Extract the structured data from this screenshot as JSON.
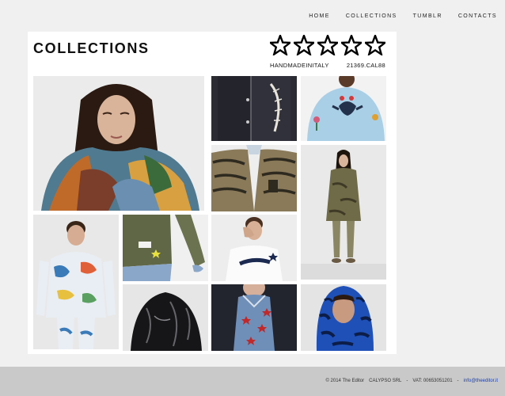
{
  "nav": {
    "items": [
      {
        "label": "HOME"
      },
      {
        "label": "COLLECTIONS"
      },
      {
        "label": "TUMBLR"
      },
      {
        "label": "CONTACTS"
      }
    ]
  },
  "header": {
    "title": "COLLECTIONS",
    "rating": 5,
    "tagline": "HANDMADEINITALY",
    "code": "21369.CAL88"
  },
  "gallery": {
    "tiles": [
      {
        "name": "woman-fur-coat-photo",
        "bg": "#eaeaea"
      },
      {
        "name": "denim-jacket-embroidery-photo",
        "bg": "#2a2a30"
      },
      {
        "name": "embroidered-eagle-jacket-photo",
        "bg": "#a8cde6"
      },
      {
        "name": "tiger-camo-jacket-photo",
        "bg": "#ececec"
      },
      {
        "name": "model-camo-parka-photo",
        "bg": "#e8e8e8"
      },
      {
        "name": "painted-print-suit-photo",
        "bg": "#e6e6e6"
      },
      {
        "name": "olive-pants-cuff-photo",
        "bg": "#5c6448"
      },
      {
        "name": "editor-tshirt-photo",
        "bg": "#ececec"
      },
      {
        "name": "black-vinyl-jacket-photo",
        "bg": "#e6e6e6"
      },
      {
        "name": "star-print-shirt-photo",
        "bg": "#1f2230"
      },
      {
        "name": "blue-zebra-parka-photo",
        "bg": "#e4e4e4"
      }
    ]
  },
  "footer": {
    "copyright": "© 2014 The Editor",
    "company": "CALYPSO SRL",
    "sep1": "-",
    "vat": "VAT: 00653051201",
    "sep2": "-",
    "email": "info@theeditor.it"
  }
}
